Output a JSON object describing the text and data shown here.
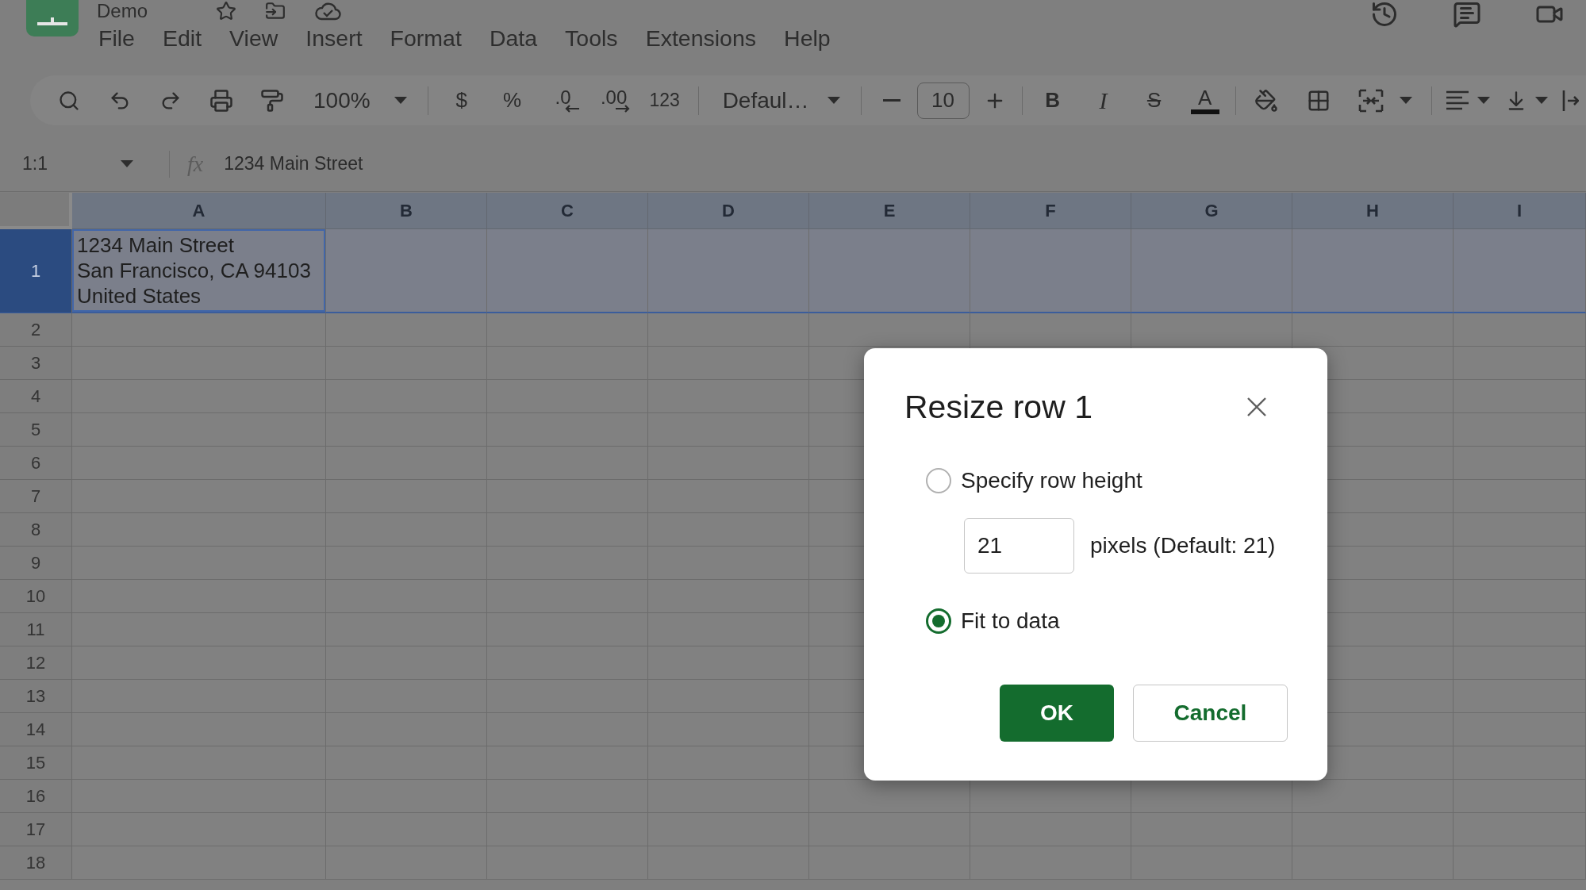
{
  "app": {
    "title": "Demo"
  },
  "menu": [
    "File",
    "Edit",
    "View",
    "Insert",
    "Format",
    "Data",
    "Tools",
    "Extensions",
    "Help"
  ],
  "toolbar": {
    "zoom": "100%",
    "currency": "$",
    "percent": "%",
    "decrease_decimal": ".0",
    "increase_decimal": ".00",
    "number_formats": "123",
    "font": "Defaul…",
    "font_size": "10",
    "bold": "B",
    "italic": "I",
    "strikethrough": "S",
    "text_color": "A"
  },
  "formula_bar": {
    "cell_reference": "1:1",
    "function_label": "fx",
    "content": "1234 Main Street"
  },
  "grid": {
    "columns": [
      {
        "label": "A",
        "highlighted": true
      },
      {
        "label": "B",
        "highlighted": true
      },
      {
        "label": "C",
        "highlighted": true
      },
      {
        "label": "D",
        "highlighted": true
      },
      {
        "label": "E",
        "highlighted": true
      },
      {
        "label": "F",
        "highlighted": true
      },
      {
        "label": "G",
        "highlighted": true
      },
      {
        "label": "H",
        "highlighted": true
      },
      {
        "label": "I",
        "highlighted": true
      }
    ],
    "rows": [
      {
        "number": "1",
        "selected": true,
        "cells": [
          {
            "value": "1234 Main Street\nSan Francisco, CA 94103\nUnited States",
            "active": true
          }
        ]
      },
      {
        "number": "2",
        "selected": false
      },
      {
        "number": "3",
        "selected": false
      },
      {
        "number": "4",
        "selected": false
      },
      {
        "number": "5",
        "selected": false
      },
      {
        "number": "6",
        "selected": false
      },
      {
        "number": "7",
        "selected": false
      },
      {
        "number": "8",
        "selected": false
      },
      {
        "number": "9",
        "selected": false
      },
      {
        "number": "10",
        "selected": false
      },
      {
        "number": "11",
        "selected": false
      },
      {
        "number": "12",
        "selected": false
      },
      {
        "number": "13",
        "selected": false
      },
      {
        "number": "14",
        "selected": false
      },
      {
        "number": "15",
        "selected": false
      },
      {
        "number": "16",
        "selected": false
      },
      {
        "number": "17",
        "selected": false
      },
      {
        "number": "18",
        "selected": false
      }
    ]
  },
  "dialog": {
    "title": "Resize row 1",
    "options": [
      {
        "label": "Specify row height",
        "selected": false,
        "field": {
          "value": "21",
          "unit": "pixels (Default: 21)"
        }
      },
      {
        "label": "Fit to data",
        "selected": true
      }
    ],
    "buttons": [
      {
        "label": "OK",
        "kind": "primary"
      },
      {
        "label": "Cancel",
        "kind": "secondary"
      }
    ]
  }
}
